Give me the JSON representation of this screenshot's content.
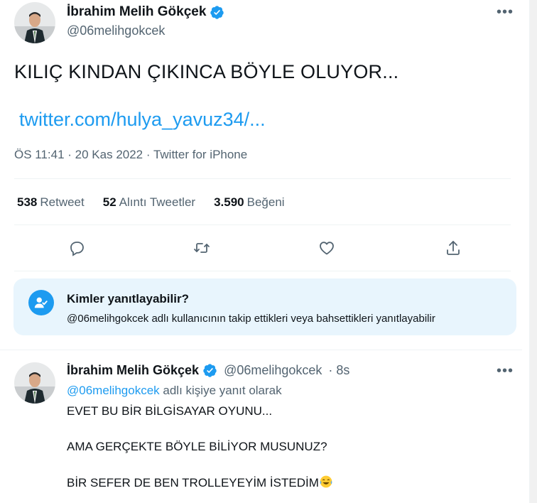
{
  "main_tweet": {
    "author_name": "İbrahim Melih Gökçek",
    "author_handle": "@06melihgokcek",
    "text": "KILIÇ KINDAN ÇIKINCA BÖYLE OLUYOR...",
    "link": "twitter.com/hulya_yavuz34/...",
    "meta": "ÖS 11:41 · 20 Kas 2022 · Twitter for iPhone",
    "more": "•••",
    "stats": [
      {
        "count": "538",
        "label": "Retweet"
      },
      {
        "count": "52",
        "label": "Alıntı Tweetler"
      },
      {
        "count": "3.590",
        "label": "Beğeni"
      }
    ]
  },
  "who_can_reply": {
    "title": "Kimler yanıtlayabilir?",
    "description": "@06melihgokcek adlı kullanıcının takip ettikleri veya bahsettikleri yanıtlayabilir"
  },
  "reply_tweet": {
    "author_name": "İbrahim Melih Gökçek",
    "author_handle": "@06melihgokcek",
    "time": "· 8s",
    "replying_mention": "@06melihgokcek",
    "replying_suffix": " adlı kişiye yanıt olarak",
    "more": "•••",
    "lines": [
      "EVET BU BİR BİLGİSAYAR OYUNU...",
      "AMA GERÇEKTE BÖYLE BİLİYOR MUSUNUZ?",
      "BİR SEFER DE BEN TROLLEYEYİM İSTEDİM"
    ]
  },
  "colors": {
    "accent": "#1d9bf0",
    "secondary_text": "#536471",
    "reply_box_bg": "#e8f5fd"
  },
  "icons": [
    "verified-badge-icon",
    "reply-icon",
    "retweet-icon",
    "like-icon",
    "share-icon",
    "people-check-icon",
    "tears-of-joy-emoji"
  ]
}
